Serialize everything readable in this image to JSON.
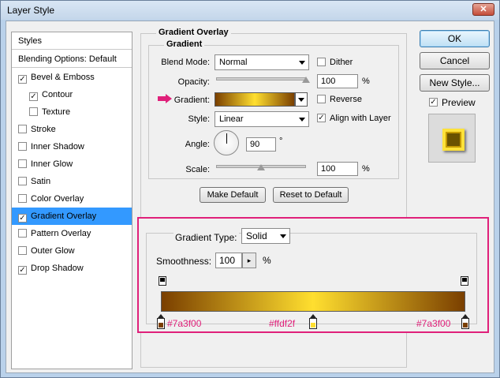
{
  "window": {
    "title": "Layer Style",
    "close_glyph": "✕"
  },
  "styles_list": {
    "header": "Styles",
    "blending": "Blending Options: Default",
    "items": [
      {
        "label": "Bevel & Emboss",
        "checked": true
      },
      {
        "label": "Contour",
        "checked": true
      },
      {
        "label": "Texture",
        "checked": false
      },
      {
        "label": "Stroke",
        "checked": false
      },
      {
        "label": "Inner Shadow",
        "checked": false
      },
      {
        "label": "Inner Glow",
        "checked": false
      },
      {
        "label": "Satin",
        "checked": false
      },
      {
        "label": "Color Overlay",
        "checked": false
      },
      {
        "label": "Gradient Overlay",
        "checked": true,
        "selected": true
      },
      {
        "label": "Pattern Overlay",
        "checked": false
      },
      {
        "label": "Outer Glow",
        "checked": false
      },
      {
        "label": "Drop Shadow",
        "checked": true
      }
    ]
  },
  "gradient_overlay": {
    "title": "Gradient Overlay",
    "subtitle": "Gradient",
    "blend_mode_label": "Blend Mode:",
    "blend_mode_value": "Normal",
    "dither_label": "Dither",
    "dither_checked": false,
    "opacity_label": "Opacity:",
    "opacity_value": "100",
    "opacity_level": 1.0,
    "percent": "%",
    "gradient_label": "Gradient:",
    "reverse_label": "Reverse",
    "reverse_checked": false,
    "style_label": "Style:",
    "style_value": "Linear",
    "align_label": "Align with Layer",
    "align_checked": true,
    "angle_label": "Angle:",
    "angle_value": "90",
    "degree": "°",
    "scale_label": "Scale:",
    "scale_value": "100",
    "scale_level": 0.5,
    "make_default": "Make Default",
    "reset_default": "Reset to Default"
  },
  "gradient_editor": {
    "type_label": "Gradient Type:",
    "type_value": "Solid",
    "smoothness_label": "Smoothness:",
    "smoothness_value": "100",
    "percent": "%",
    "stops": [
      {
        "color": "#7a3f00",
        "label": "#7a3f00",
        "location": 0
      },
      {
        "color": "#ffdf2f",
        "label": "#ffdf2f",
        "location": 50
      },
      {
        "color": "#7a3f00",
        "label": "#7a3f00",
        "location": 100
      }
    ]
  },
  "actions": {
    "ok": "OK",
    "cancel": "Cancel",
    "new_style": "New Style...",
    "preview_label": "Preview",
    "preview_checked": true
  },
  "colors": {
    "accent_pink": "#e0207a",
    "selection_blue": "#3399ff",
    "gradient_dark": "#7a3f00",
    "gradient_light": "#ffdf2f"
  },
  "icons": {
    "pink_arrow": "pink-arrow-icon",
    "checkmark": "✓"
  }
}
